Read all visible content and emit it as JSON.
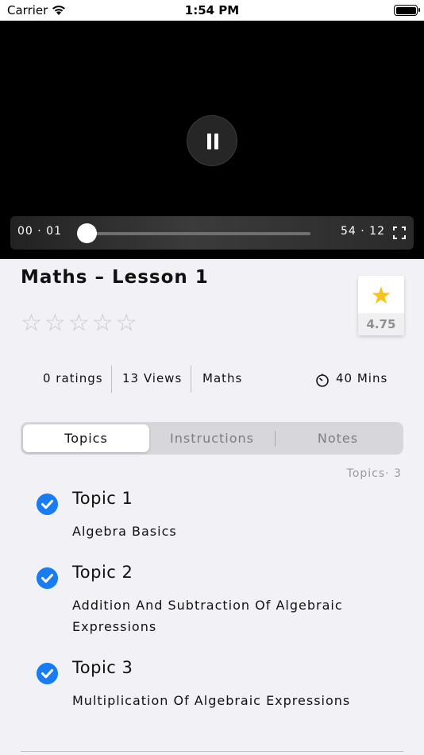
{
  "status_bar": {
    "carrier": "Carrier",
    "time": "1:54 PM"
  },
  "player": {
    "current_time": "00 · 01",
    "duration": "54 · 12",
    "progress": 0.0003
  },
  "lesson": {
    "title": "Maths – Lesson 1",
    "user_stars": 0,
    "star_count": 5,
    "average_rating": "4.75"
  },
  "stats": {
    "ratings": "0 ratings",
    "views": "13 Views",
    "subject": "Maths",
    "duration": "40 Mins"
  },
  "tabs": [
    {
      "label": "Topics",
      "active": true
    },
    {
      "label": "Instructions",
      "active": false
    },
    {
      "label": "Notes",
      "active": false
    }
  ],
  "topics_count": "Topics· 3",
  "topics": [
    {
      "title": "Topic 1",
      "description": "Algebra Basics",
      "completed": true
    },
    {
      "title": "Topic 2",
      "description": "Addition And Subtraction Of Algebraic Expressions",
      "completed": true
    },
    {
      "title": "Topic 3",
      "description": "Multiplication Of Algebraic Expressions",
      "completed": true
    }
  ],
  "colors": {
    "accent": "#1a7cf2",
    "star_gold": "#f7c31a",
    "background": "#f2f2f6"
  },
  "icons": [
    "wifi-icon",
    "battery-icon",
    "pause-icon",
    "fullscreen-icon",
    "star-icon",
    "timer-icon",
    "checkmark-icon"
  ]
}
